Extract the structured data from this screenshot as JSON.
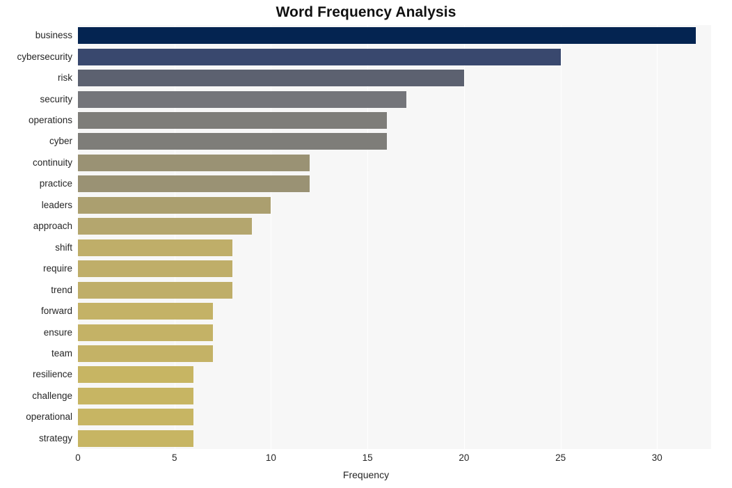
{
  "chart_data": {
    "type": "bar",
    "orientation": "horizontal",
    "title": "Word Frequency Analysis",
    "xlabel": "Frequency",
    "ylabel": "",
    "xlim": [
      0,
      32.8
    ],
    "ylim": [
      0,
      20
    ],
    "grid": true,
    "legend": null,
    "xticks": [
      0,
      5,
      10,
      15,
      20,
      25,
      30
    ],
    "xtick_labels": [
      "0",
      "5",
      "10",
      "15",
      "20",
      "25",
      "30"
    ],
    "categories": [
      "business",
      "cybersecurity",
      "risk",
      "security",
      "operations",
      "cyber",
      "continuity",
      "practice",
      "leaders",
      "approach",
      "shift",
      "require",
      "trend",
      "forward",
      "ensure",
      "team",
      "resilience",
      "challenge",
      "operational",
      "strategy"
    ],
    "values": [
      32,
      25,
      20,
      17,
      16,
      16,
      12,
      12,
      10,
      9,
      8,
      8,
      8,
      7,
      7,
      7,
      6,
      6,
      6,
      6
    ],
    "bar_colors": [
      "#042451",
      "#39486e",
      "#5c6170",
      "#74757a",
      "#7e7d79",
      "#7e7d79",
      "#9a9274",
      "#9a9274",
      "#ab9f6f",
      "#b4a66e",
      "#bfae69",
      "#bfae69",
      "#bfae69",
      "#c4b266",
      "#c4b266",
      "#c4b266",
      "#c7b563",
      "#c7b563",
      "#c7b563",
      "#c7b563"
    ],
    "plot_background": "#f7f7f7",
    "figure_background": "#ffffff",
    "gridline_color": "#ffffff",
    "text_color": "#262626"
  }
}
